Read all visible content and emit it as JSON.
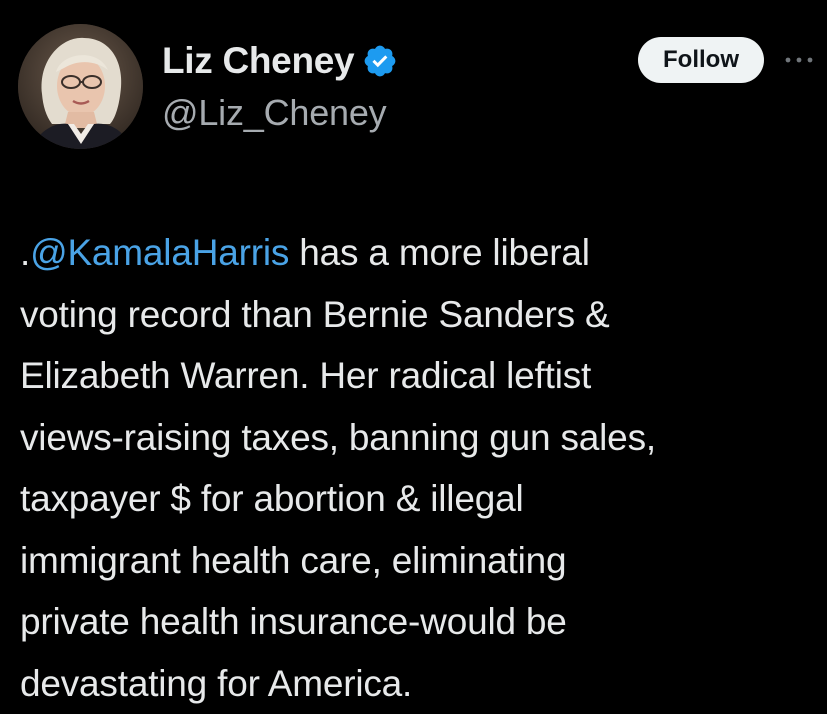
{
  "author": {
    "display_name": "Liz Cheney",
    "handle": "@Liz_Cheney",
    "verified_icon": "verified-badge-icon",
    "avatar_icon": "profile-photo"
  },
  "actions": {
    "follow_label": "Follow",
    "more_icon": "more-options-icon"
  },
  "tweet": {
    "prefix": ".",
    "mention": "@KamalaHarris",
    "line1_rest": " has a more liberal",
    "lines": [
      "voting record than Bernie Sanders &",
      "Elizabeth Warren. Her radical leftist",
      "views-raising taxes, banning gun sales,",
      "taxpayer $ for abortion & illegal",
      "immigrant health care, eliminating",
      "private health insurance-would be",
      "devastating for America."
    ]
  },
  "colors": {
    "background": "#000000",
    "text": "#e7e9ea",
    "secondary_text": "#a6abb0",
    "link": "#4aa3e6",
    "verified": "#1d9bf0",
    "follow_bg": "#eff3f4"
  }
}
